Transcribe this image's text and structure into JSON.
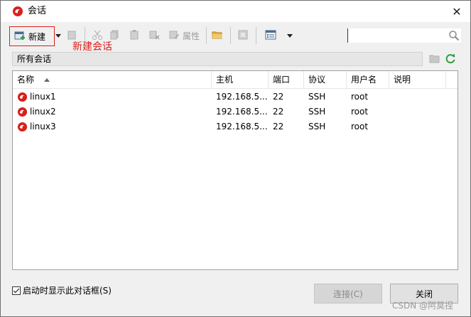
{
  "window": {
    "title": "会话",
    "close_glyph": "✕"
  },
  "toolbar": {
    "new_label": "新建",
    "properties_label": "属性",
    "annotation": "新建会话",
    "search_placeholder": ""
  },
  "path_bar": {
    "label": "所有会话"
  },
  "table": {
    "columns": [
      "名称",
      "主机",
      "端口",
      "协议",
      "用户名",
      "说明"
    ],
    "rows": [
      {
        "name": "linux1",
        "host": "192.168.5...",
        "port": "22",
        "protocol": "SSH",
        "user": "root",
        "desc": ""
      },
      {
        "name": "linux2",
        "host": "192.168.5...",
        "port": "22",
        "protocol": "SSH",
        "user": "root",
        "desc": ""
      },
      {
        "name": "linux3",
        "host": "192.168.5...",
        "port": "22",
        "protocol": "SSH",
        "user": "root",
        "desc": ""
      }
    ]
  },
  "footer": {
    "startup_label": "启动时显示此对话框(S)",
    "startup_checked": true,
    "connect_label": "连接(C)",
    "close_label": "关闭"
  },
  "watermark": "CSDN @阿莫捏",
  "colors": {
    "accent": "#d9211b",
    "refresh": "#2e9e3a"
  },
  "icons": [
    "session-logo-icon",
    "close-icon",
    "new-session-icon",
    "copy-icon",
    "cut-icon",
    "paste-icon",
    "delete-icon",
    "properties-icon",
    "folder-icon",
    "layout-icon",
    "search-icon",
    "refresh-icon"
  ]
}
